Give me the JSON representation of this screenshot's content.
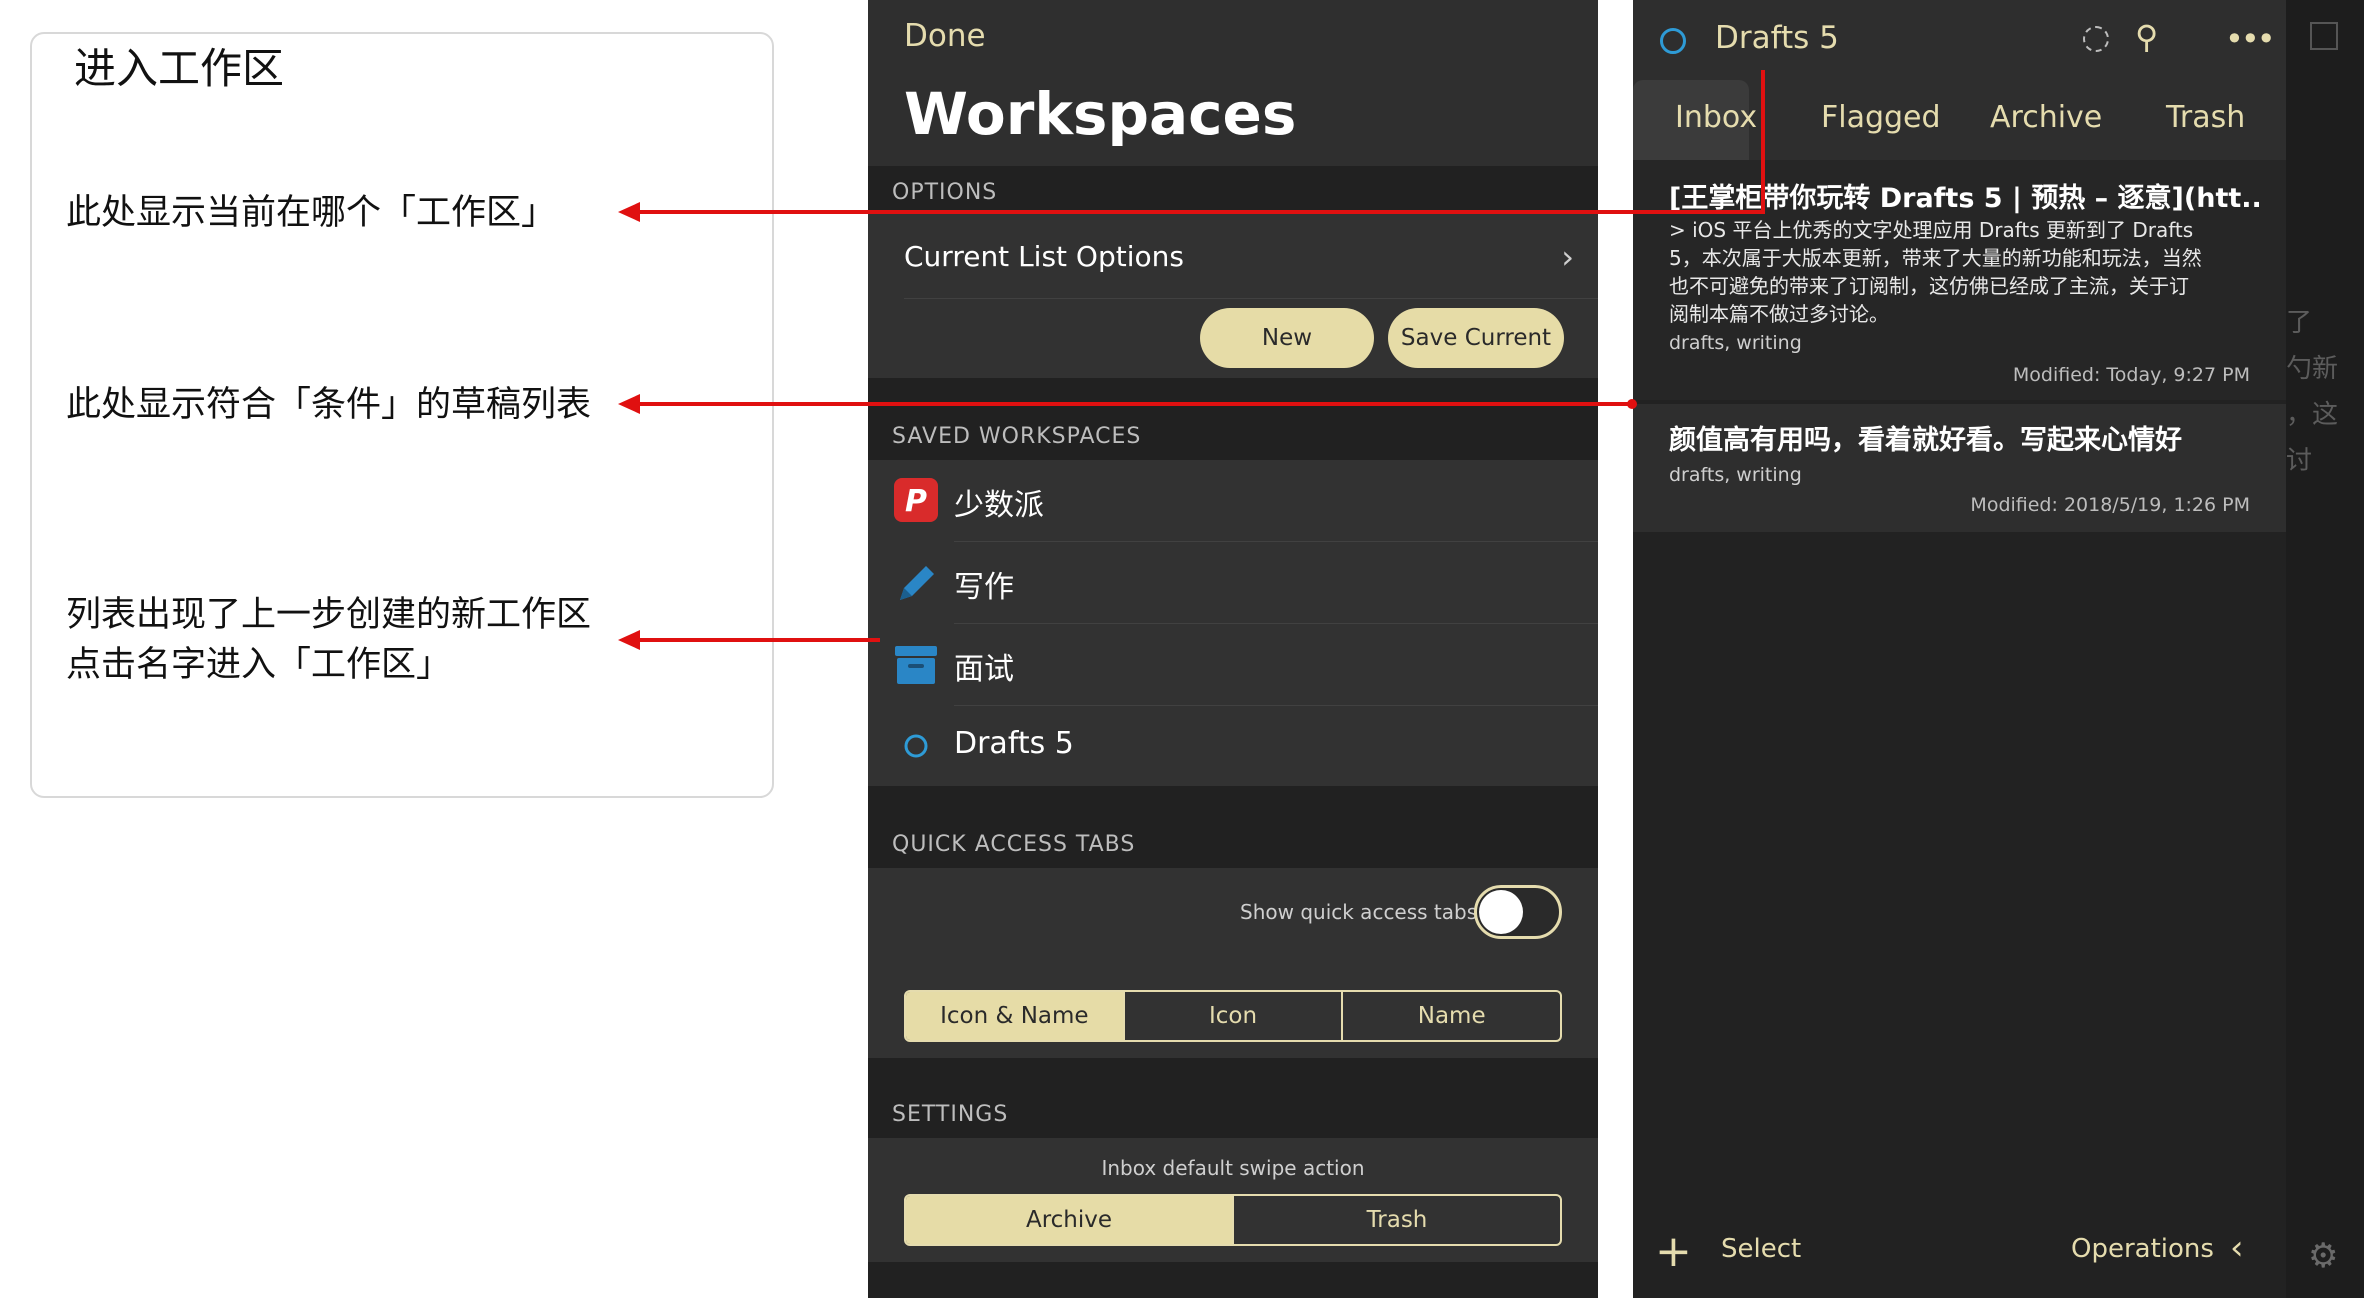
{
  "annotation": {
    "title": "进入工作区",
    "notes": [
      "此处显示当前在哪个「工作区」",
      "此处显示符合「条件」的草稿列表",
      "列表出现了上一步创建的新工作区",
      "点击名字进入「工作区」"
    ]
  },
  "workspaces_panel": {
    "done_label": "Done",
    "title": "Workspaces",
    "options_header": "OPTIONS",
    "current_list_options": "Current List Options",
    "new_label": "New",
    "save_current_label": "Save Current",
    "saved_header": "SAVED WORKSPACES",
    "saved": [
      {
        "label": "少数派",
        "icon": "sspai-p-icon"
      },
      {
        "label": "写作",
        "icon": "pen-icon"
      },
      {
        "label": "面试",
        "icon": "archive-box-icon"
      },
      {
        "label": "Drafts 5",
        "icon": "circle-icon"
      }
    ],
    "quick_header": "QUICK ACCESS TABS",
    "show_quick_tabs_label": "Show quick access tabs",
    "show_quick_tabs_on": false,
    "tab_style_options": [
      "Icon & Name",
      "Icon",
      "Name"
    ],
    "tab_style_selected": "Icon & Name",
    "settings_header": "SETTINGS",
    "swipe_label": "Inbox default swipe action",
    "swipe_options": [
      "Archive",
      "Trash"
    ],
    "swipe_selected": "Archive"
  },
  "drafts_panel": {
    "workspace_name": "Drafts 5",
    "tabs": [
      "Inbox",
      "Flagged",
      "Archive",
      "Trash"
    ],
    "active_tab": "Inbox",
    "drafts": [
      {
        "title": "[王掌柜带你玩转 Drafts 5 | 预热 – 逐意](htt...",
        "body_lines": [
          "> iOS 平台上优秀的文字处理应用 Drafts 更新到了 Drafts",
          "5，本次属于大版本更新，带来了大量的新功能和玩法，当然",
          "也不可避免的带来了订阅制，这仿佛已经成了主流，关于订",
          "阅制本篇不做过多讨论。"
        ],
        "tags": "drafts, writing",
        "modified": "Modified: Today, 9:27 PM"
      },
      {
        "title": "颜值高有用吗，看着就好看。写起来心情好",
        "tags": "drafts, writing",
        "modified": "Modified: 2018/5/19, 1:26 PM"
      }
    ],
    "select_label": "Select",
    "operations_label": "Operations"
  },
  "side_strip": {
    "text_lines": [
      "了",
      "勺新",
      "，这",
      "讨"
    ]
  },
  "colors": {
    "accent": "#e6dca7",
    "arrow": "#e01010",
    "panel_bg": "#212121",
    "drafts_icon": "#2e9bd6"
  }
}
